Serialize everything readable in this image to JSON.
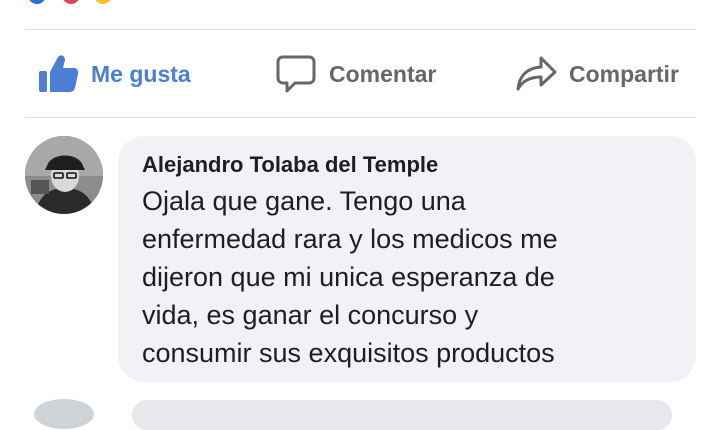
{
  "colors": {
    "like_blue": "#4a7fd1",
    "action_gray": "#65676b",
    "bubble_bg": "#f0f2f5",
    "text_dark": "#1c1e21"
  },
  "actions": [
    {
      "label": "Me gusta",
      "icon": "thumbs-up-icon",
      "active": true
    },
    {
      "label": "Comentar",
      "icon": "comment-icon",
      "active": false
    },
    {
      "label": "Compartir",
      "icon": "share-icon",
      "active": false
    }
  ],
  "comment": {
    "author": "Alejandro Tolaba del Temple",
    "lines": [
      "Ojala que gane. Tengo una",
      "enfermedad rara y los medicos me",
      "dijeron que mi unica esperanza de",
      "vida, es ganar el concurso y",
      "consumir sus exquisitos productos"
    ],
    "avatar_icon": "profile-photo"
  }
}
